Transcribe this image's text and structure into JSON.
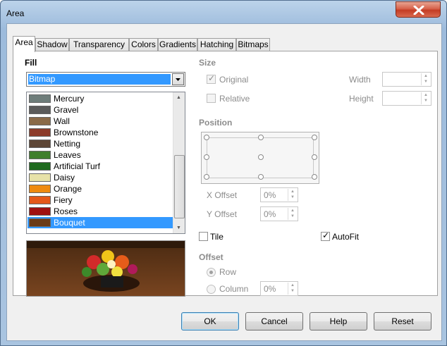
{
  "window": {
    "title": "Area"
  },
  "tabs": [
    "Area",
    "Shadow",
    "Transparency",
    "Colors",
    "Gradients",
    "Hatching",
    "Bitmaps"
  ],
  "fill": {
    "heading": "Fill",
    "selected": "Bitmap",
    "bitmaps": [
      {
        "name": "Mercury",
        "color": "#6e7d7a"
      },
      {
        "name": "Gravel",
        "color": "#5b5b5b"
      },
      {
        "name": "Wall",
        "color": "#8a6a48"
      },
      {
        "name": "Brownstone",
        "color": "#8c3b2a"
      },
      {
        "name": "Netting",
        "color": "#5e4636"
      },
      {
        "name": "Leaves",
        "color": "#3f7f2c"
      },
      {
        "name": "Artificial Turf",
        "color": "#1f6b1f"
      },
      {
        "name": "Daisy",
        "color": "#e7e2a8"
      },
      {
        "name": "Orange",
        "color": "#ee8a10"
      },
      {
        "name": "Fiery",
        "color": "#e4581a"
      },
      {
        "name": "Roses",
        "color": "#a01010"
      },
      {
        "name": "Bouquet",
        "color": "#6a3b18"
      }
    ],
    "selected_bitmap": "Bouquet"
  },
  "size": {
    "heading": "Size",
    "original_label": "Original",
    "relative_label": "Relative",
    "width_label": "Width",
    "height_label": "Height",
    "width_value": "",
    "height_value": ""
  },
  "position": {
    "heading": "Position",
    "x_offset_label": "X Offset",
    "y_offset_label": "Y Offset",
    "x_offset_value": "0%",
    "y_offset_value": "0%"
  },
  "tile_label": "Tile",
  "autofit_label": "AutoFit",
  "offset": {
    "heading": "Offset",
    "row_label": "Row",
    "column_label": "Column",
    "value": "0%"
  },
  "buttons": {
    "ok": "OK",
    "cancel": "Cancel",
    "help": "Help",
    "reset": "Reset"
  },
  "colors": {
    "selection": "#3399ff",
    "close_button": "#c43c24"
  }
}
